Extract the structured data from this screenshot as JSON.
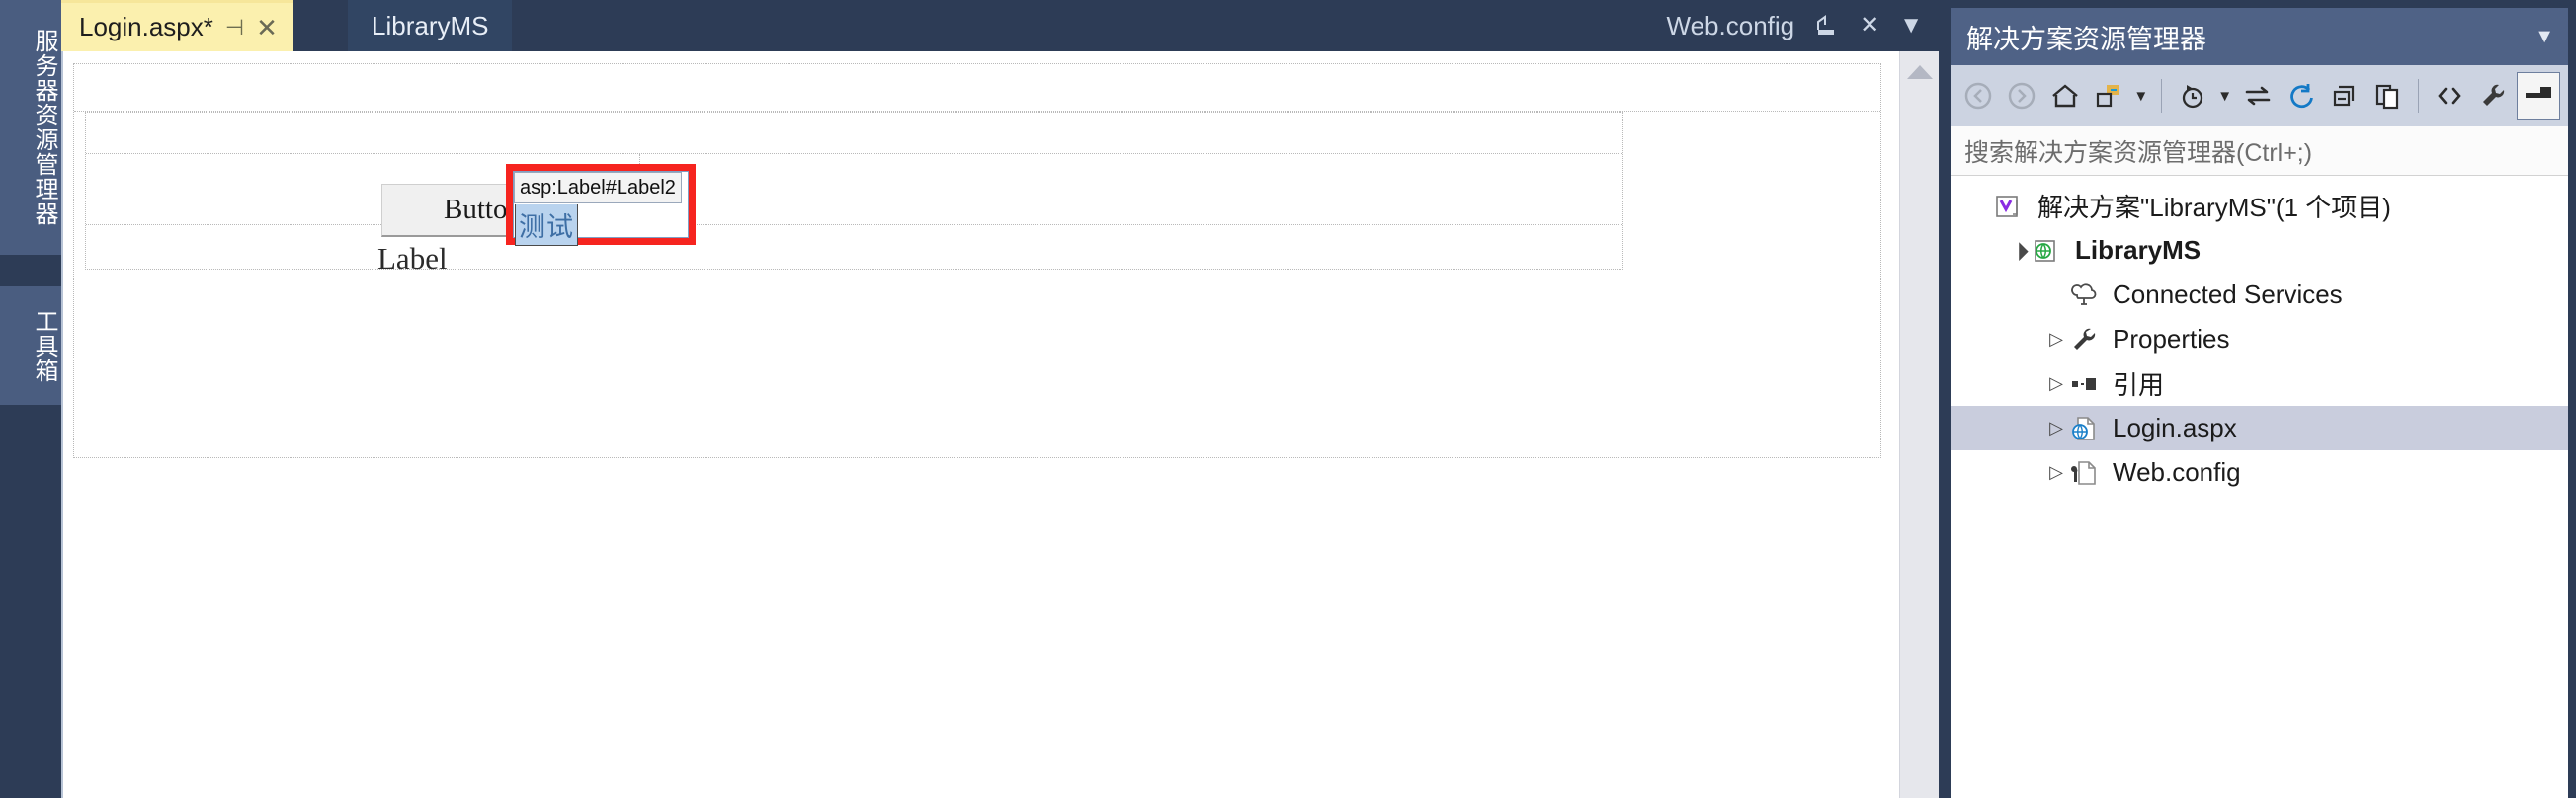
{
  "left_dock": {
    "tabs": [
      {
        "name": "server-explorer",
        "label": "服务器资源管理器"
      },
      {
        "name": "toolbox",
        "label": "工具箱"
      }
    ]
  },
  "tabstrip": {
    "tabs": [
      {
        "label": "Login.aspx*",
        "active": true,
        "pin_icon": "pin-icon",
        "close_icon": "close-icon"
      },
      {
        "label": "LibraryMS",
        "active": false
      }
    ],
    "right": {
      "label": "Web.config",
      "restore_icon": "restore-window-icon",
      "close_icon": "close-icon",
      "menu_icon": "chevron-down-icon"
    }
  },
  "designer": {
    "button": {
      "text": "Button"
    },
    "label": {
      "text": "Label"
    },
    "selected_control": {
      "tag": "asp:Label#Label2",
      "text": "测试",
      "highlight_color": "#f6241f",
      "selection_color": "#b9d3ee"
    },
    "scrollbar": {
      "up_arrow": "scroll-up-arrow"
    }
  },
  "solution_explorer": {
    "title": "解决方案资源管理器",
    "collapse_icon": "chevron-down-icon",
    "toolbar": [
      {
        "name": "back-button",
        "glyph": "◀",
        "dim": true
      },
      {
        "name": "forward-button",
        "glyph": "▶",
        "dim": true
      },
      {
        "name": "home-button",
        "glyph": "home-icon"
      },
      {
        "name": "pending-changes-button",
        "glyph": "folder-icon"
      },
      {
        "name": "pending-changes-caret",
        "glyph": "▾"
      },
      {
        "name": "show-history-button",
        "glyph": "clock-icon"
      },
      {
        "name": "show-history-caret",
        "glyph": "▾"
      },
      {
        "name": "sync-button",
        "glyph": "sync-icon"
      },
      {
        "name": "refresh-button",
        "glyph": "refresh-icon"
      },
      {
        "name": "collapse-all-button",
        "glyph": "collapse-icon"
      },
      {
        "name": "show-all-files-button",
        "glyph": "documents-icon"
      },
      {
        "name": "view-code-button",
        "glyph": "code-icon"
      },
      {
        "name": "properties-button",
        "glyph": "wrench-icon"
      },
      {
        "name": "preview-selected-items-button",
        "glyph": "preview-icon"
      }
    ],
    "search_placeholder": "搜索解决方案资源管理器(Ctrl+;)",
    "tree": [
      {
        "label": "解决方案\"LibraryMS\"(1 个项目)",
        "indent": 0,
        "arrow": "",
        "icon": "solution-icon",
        "bold": false,
        "selected": false
      },
      {
        "label": "LibraryMS",
        "indent": 1,
        "arrow": "▲",
        "icon": "web-project-icon",
        "bold": true,
        "selected": false
      },
      {
        "label": "Connected Services",
        "indent": 2,
        "arrow": "",
        "icon": "connected-services-icon",
        "bold": false,
        "selected": false
      },
      {
        "label": "Properties",
        "indent": 2,
        "arrow": "▷",
        "icon": "wrench-icon",
        "bold": false,
        "selected": false
      },
      {
        "label": "引用",
        "indent": 2,
        "arrow": "▷",
        "icon": "references-icon",
        "bold": false,
        "selected": false
      },
      {
        "label": "Login.aspx",
        "indent": 2,
        "arrow": "▷",
        "icon": "web-file-icon",
        "bold": false,
        "selected": true
      },
      {
        "label": "Web.config",
        "indent": 2,
        "arrow": "▷",
        "icon": "config-file-icon",
        "bold": false,
        "selected": false
      }
    ]
  }
}
